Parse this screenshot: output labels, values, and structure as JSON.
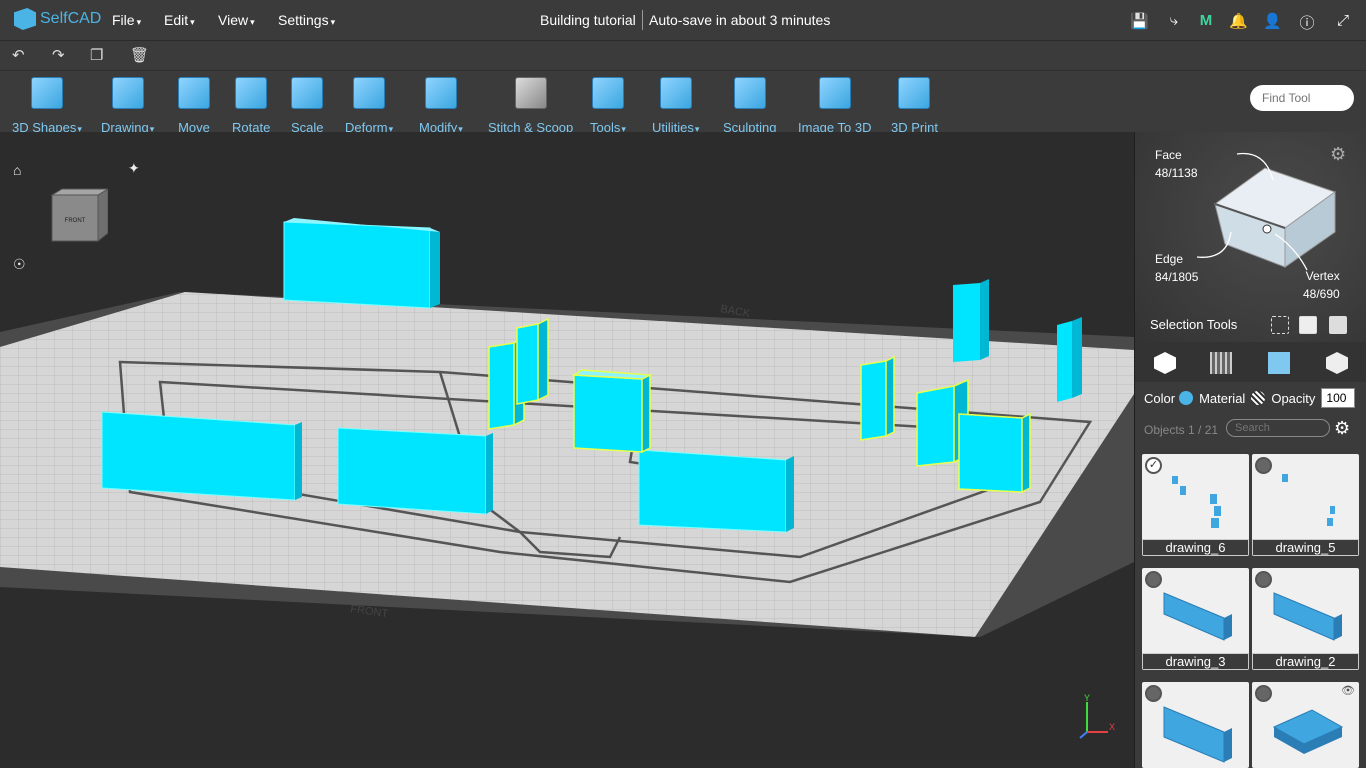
{
  "app": {
    "logo": "SelfCAD"
  },
  "menubar": {
    "items": [
      "File",
      "Edit",
      "View",
      "Settings"
    ],
    "title": "Building tutorial",
    "autosave": "Auto-save in about 3 minutes"
  },
  "toolbar": {
    "tools": [
      {
        "label": "3D Shapes",
        "icon": "cube-icon",
        "dropdown": true
      },
      {
        "label": "Drawing",
        "icon": "drawing-icon",
        "dropdown": true
      },
      {
        "label": "Move",
        "icon": "move-icon",
        "dropdown": false
      },
      {
        "label": "Rotate",
        "icon": "rotate-icon",
        "dropdown": false
      },
      {
        "label": "Scale",
        "icon": "scale-icon",
        "dropdown": false
      },
      {
        "label": "Deform",
        "icon": "deform-icon",
        "dropdown": true
      },
      {
        "label": "Modify",
        "icon": "modify-icon",
        "dropdown": true
      },
      {
        "label": "Stitch & Scoop",
        "icon": "stitch-scoop-icon",
        "dropdown": false
      },
      {
        "label": "Tools",
        "icon": "tools-icon",
        "dropdown": true
      },
      {
        "label": "Utilities",
        "icon": "utilities-icon",
        "dropdown": true
      },
      {
        "label": "Sculpting",
        "icon": "sculpting-icon",
        "dropdown": false
      },
      {
        "label": "Image To 3D",
        "icon": "image-to-3d-icon",
        "dropdown": false
      },
      {
        "label": "3D Print",
        "icon": "3d-print-icon",
        "dropdown": false
      }
    ],
    "find_placeholder": "Find Tool"
  },
  "viewport": {
    "navcube_label": "FRONT",
    "floor_labels": {
      "back": "BACK",
      "front": "FRONT"
    },
    "axis": {
      "x": "X",
      "y": "Y",
      "z": "Z"
    },
    "colors": {
      "object": "#00e5ff",
      "selected_edge": "#e6ff4d",
      "floor": "#d6d6d6"
    }
  },
  "panel": {
    "face": {
      "label": "Face",
      "count": "48/1138"
    },
    "edge": {
      "label": "Edge",
      "count": "84/1805"
    },
    "vertex": {
      "label": "Vertex",
      "count": "48/690"
    },
    "selection_tools_label": "Selection Tools",
    "color_label": "Color",
    "material_label": "Material",
    "opacity_label": "Opacity",
    "opacity_value": "100",
    "objects_label": "Objects 1 / 21",
    "search_placeholder": "Search",
    "objects": [
      {
        "name": "drawing_6",
        "checked": true
      },
      {
        "name": "drawing_5",
        "checked": false
      },
      {
        "name": "drawing_3",
        "checked": false
      },
      {
        "name": "drawing_2",
        "checked": false
      },
      {
        "name": "",
        "checked": false
      },
      {
        "name": "",
        "checked": false
      }
    ]
  }
}
